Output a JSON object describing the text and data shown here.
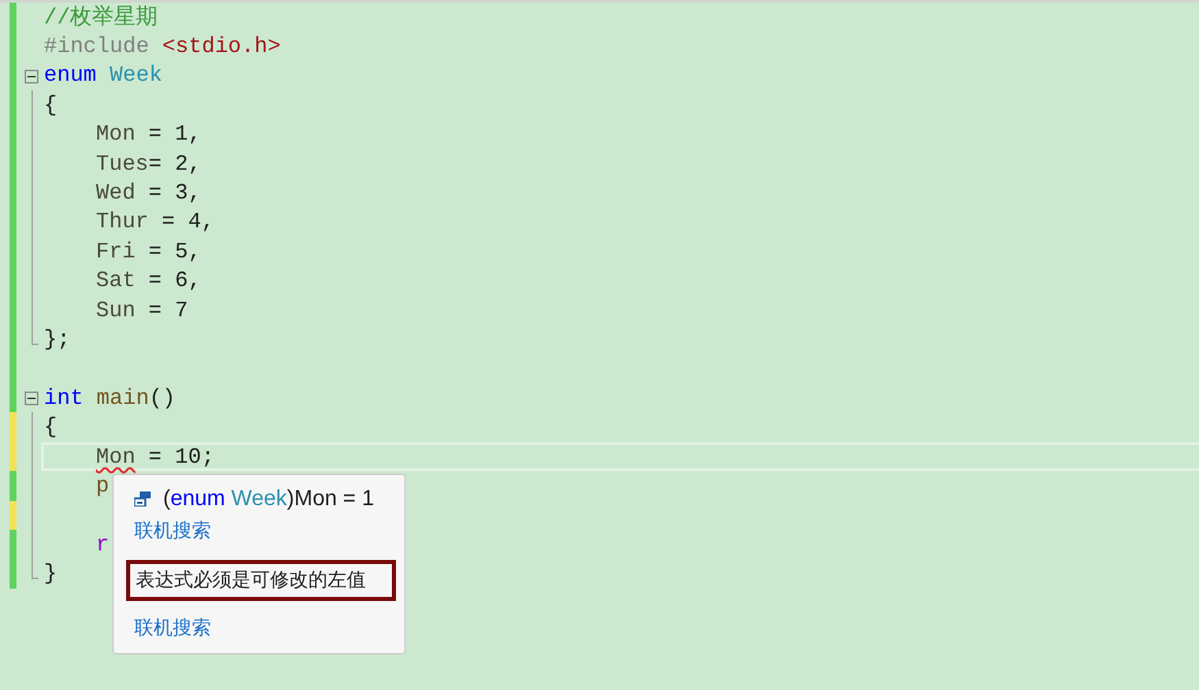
{
  "editor": {
    "lines": [
      {
        "unsaved": false,
        "collapsible": false,
        "in_block": false,
        "block_end": false,
        "indented": false,
        "current": false,
        "tokens": [
          {
            "kind": "comment",
            "text": "//枚举星期"
          }
        ]
      },
      {
        "unsaved": false,
        "collapsible": false,
        "in_block": false,
        "block_end": false,
        "indented": false,
        "current": false,
        "tokens": [
          {
            "kind": "preprocessor",
            "text": "#include "
          },
          {
            "kind": "string",
            "text": "<stdio.h>"
          }
        ]
      },
      {
        "unsaved": false,
        "collapsible": true,
        "in_block": false,
        "block_end": false,
        "indented": false,
        "current": false,
        "tokens": [
          {
            "kind": "keyword",
            "text": "enum "
          },
          {
            "kind": "type",
            "text": "Week"
          }
        ]
      },
      {
        "unsaved": false,
        "collapsible": false,
        "in_block": true,
        "block_end": false,
        "indented": false,
        "current": false,
        "tokens": [
          {
            "kind": "plain",
            "text": "{"
          }
        ]
      },
      {
        "unsaved": false,
        "collapsible": false,
        "in_block": true,
        "block_end": false,
        "indented": true,
        "current": false,
        "tokens": [
          {
            "kind": "identifier",
            "text": "Mon"
          },
          {
            "kind": "plain",
            "text": " = 1,"
          }
        ]
      },
      {
        "unsaved": false,
        "collapsible": false,
        "in_block": true,
        "block_end": false,
        "indented": true,
        "current": false,
        "tokens": [
          {
            "kind": "identifier",
            "text": "Tues"
          },
          {
            "kind": "plain",
            "text": "= 2,"
          }
        ]
      },
      {
        "unsaved": false,
        "collapsible": false,
        "in_block": true,
        "block_end": false,
        "indented": true,
        "current": false,
        "tokens": [
          {
            "kind": "identifier",
            "text": "Wed"
          },
          {
            "kind": "plain",
            "text": " = 3,"
          }
        ]
      },
      {
        "unsaved": false,
        "collapsible": false,
        "in_block": true,
        "block_end": false,
        "indented": true,
        "current": false,
        "tokens": [
          {
            "kind": "identifier",
            "text": "Thur"
          },
          {
            "kind": "plain",
            "text": " = 4,"
          }
        ]
      },
      {
        "unsaved": false,
        "collapsible": false,
        "in_block": true,
        "block_end": false,
        "indented": true,
        "current": false,
        "tokens": [
          {
            "kind": "identifier",
            "text": "Fri"
          },
          {
            "kind": "plain",
            "text": " = 5,"
          }
        ]
      },
      {
        "unsaved": false,
        "collapsible": false,
        "in_block": true,
        "block_end": false,
        "indented": true,
        "current": false,
        "tokens": [
          {
            "kind": "identifier",
            "text": "Sat"
          },
          {
            "kind": "plain",
            "text": " = 6,"
          }
        ]
      },
      {
        "unsaved": false,
        "collapsible": false,
        "in_block": true,
        "block_end": false,
        "indented": true,
        "current": false,
        "tokens": [
          {
            "kind": "identifier",
            "text": "Sun"
          },
          {
            "kind": "plain",
            "text": " = 7"
          }
        ]
      },
      {
        "unsaved": false,
        "collapsible": false,
        "in_block": true,
        "block_end": true,
        "indented": false,
        "current": false,
        "tokens": [
          {
            "kind": "plain",
            "text": "};"
          }
        ]
      },
      {
        "unsaved": false,
        "collapsible": false,
        "in_block": false,
        "block_end": false,
        "indented": false,
        "current": false
      },
      {
        "unsaved": false,
        "collapsible": true,
        "in_block": false,
        "block_end": false,
        "indented": false,
        "current": false,
        "tokens": [
          {
            "kind": "keyword",
            "text": "int "
          },
          {
            "kind": "function",
            "text": "main"
          },
          {
            "kind": "plain",
            "text": "()"
          }
        ]
      },
      {
        "unsaved": true,
        "collapsible": false,
        "in_block": true,
        "block_end": false,
        "indented": false,
        "current": false,
        "tokens": [
          {
            "kind": "plain",
            "text": "{"
          }
        ]
      },
      {
        "unsaved": true,
        "collapsible": false,
        "in_block": true,
        "block_end": false,
        "indented": true,
        "current": true,
        "tokens": [
          {
            "kind": "identifier",
            "text": "Mon",
            "error": true
          },
          {
            "kind": "plain",
            "text": " = 10;"
          }
        ]
      },
      {
        "unsaved": false,
        "collapsible": false,
        "in_block": true,
        "block_end": false,
        "indented": true,
        "current": false,
        "tokens": [
          {
            "kind": "function",
            "text": "p"
          }
        ]
      },
      {
        "unsaved": true,
        "collapsible": false,
        "in_block": true,
        "block_end": false,
        "indented": false,
        "current": false
      },
      {
        "unsaved": false,
        "collapsible": false,
        "in_block": true,
        "block_end": false,
        "indented": true,
        "current": false,
        "tokens": [
          {
            "kind": "control",
            "text": "r"
          }
        ]
      },
      {
        "unsaved": false,
        "collapsible": false,
        "in_block": true,
        "block_end": true,
        "indented": false,
        "current": false,
        "tokens": [
          {
            "kind": "plain",
            "text": "}"
          }
        ]
      }
    ]
  },
  "quick_info": {
    "signature": [
      {
        "kind": "plain",
        "text": "("
      },
      {
        "kind": "keyword",
        "text": "enum "
      },
      {
        "kind": "type",
        "text": "Week"
      },
      {
        "kind": "plain",
        "text": ")Mon = 1"
      }
    ],
    "search_link": "联机搜索",
    "error_message": "表达式必须是可修改的左值",
    "error_search_link": "联机搜索"
  }
}
